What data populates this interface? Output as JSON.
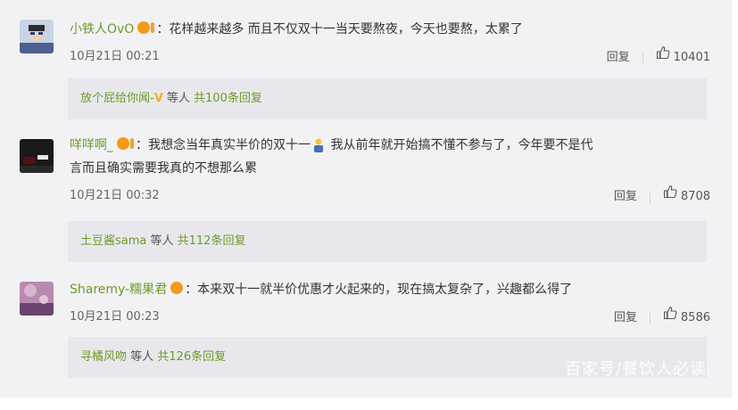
{
  "comments": [
    {
      "username": "小铁人OvO",
      "badge_label": "",
      "text": "：花样越来越多 而且不仅双十一当天要熬夜，今天也要熬，太累了",
      "time": "10月21日 00:21",
      "reply_label": "回复",
      "likes": "10401",
      "reply_users": "放个屁给你闻-",
      "reply_emoji": "V",
      "reply_mid": " 等人 ",
      "reply_total": "共100条回复"
    },
    {
      "username": "咩咩啊_",
      "badge_label": "",
      "text": "：我想念当年真实半价的双十一",
      "text_after": " 我从前年就开始搞不懂不参与了，今年要不是代",
      "text_line2": "言而且确实需要我真的不想那么累",
      "time": "10月21日 00:32",
      "reply_label": "回复",
      "likes": "8708",
      "reply_users": "土豆酱sama",
      "reply_mid": " 等人 ",
      "reply_total": "共112条回复"
    },
    {
      "username": "Sharemy-糯果君",
      "text": "：本来双十一就半价优惠才火起来的，现在搞太复杂了，兴趣都么得了",
      "time": "10月21日 00:23",
      "reply_label": "回复",
      "likes": "8586",
      "reply_users": "寻橘风吻",
      "reply_mid": " 等人 ",
      "reply_total": "共126条回复"
    }
  ],
  "watermark": "百家号/餐饮人必读",
  "colors": {
    "panel": "#f2f2f5",
    "username": "#6f9a2c",
    "badge": "#f39a1b",
    "reply_box": "#e8e8ec"
  },
  "icons": [
    "thumbs-up-icon",
    "vip-badge-icon",
    "avatar"
  ]
}
